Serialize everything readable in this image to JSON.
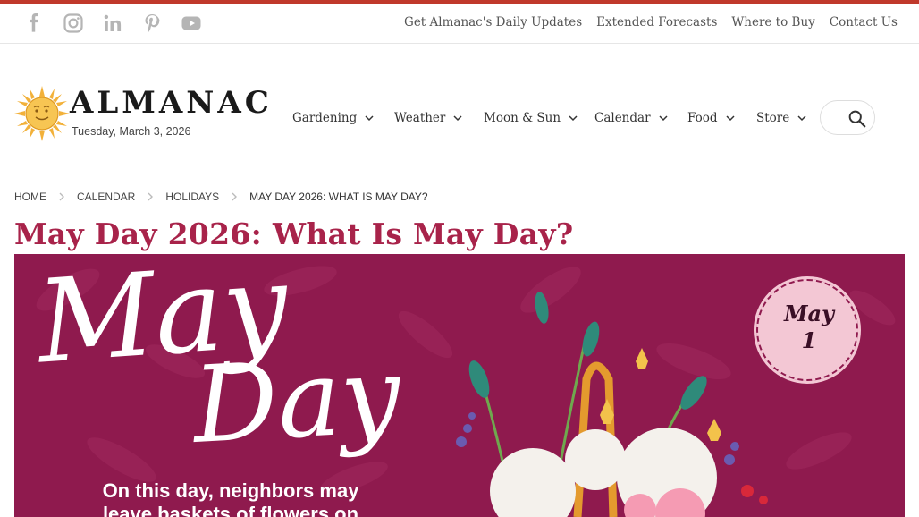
{
  "social": {
    "icons": [
      "facebook-icon",
      "instagram-icon",
      "linkedin-icon",
      "pinterest-icon",
      "youtube-icon"
    ]
  },
  "utility_links": {
    "daily_updates": "Get Almanac's Daily Updates",
    "extended_forecasts": "Extended Forecasts",
    "where_to_buy": "Where to Buy",
    "contact": "Contact Us"
  },
  "logo": {
    "wordmark": "ALMANAC",
    "date": "Tuesday, March 3, 2026"
  },
  "nav": {
    "gardening": "Gardening",
    "weather": "Weather",
    "moon_sun": "Moon & Sun",
    "calendar": "Calendar",
    "food": "Food",
    "store": "Store"
  },
  "breadcrumb": {
    "home": "HOME",
    "calendar": "CALENDAR",
    "holidays": "HOLIDAYS",
    "current": "MAY DAY 2026: WHAT IS MAY DAY?"
  },
  "page": {
    "title": "May Day 2026: What Is May Day?"
  },
  "hero": {
    "script_may": "May",
    "script_day": "Day",
    "badge_month": "May",
    "badge_day": "1",
    "caption": "On this day, neighbors may leave baskets of flowers on"
  },
  "colors": {
    "accent_red": "#c0392b",
    "title_magenta": "#a8234a",
    "hero_bg": "#8f1a4e",
    "badge_pink": "#f3c7d4"
  }
}
